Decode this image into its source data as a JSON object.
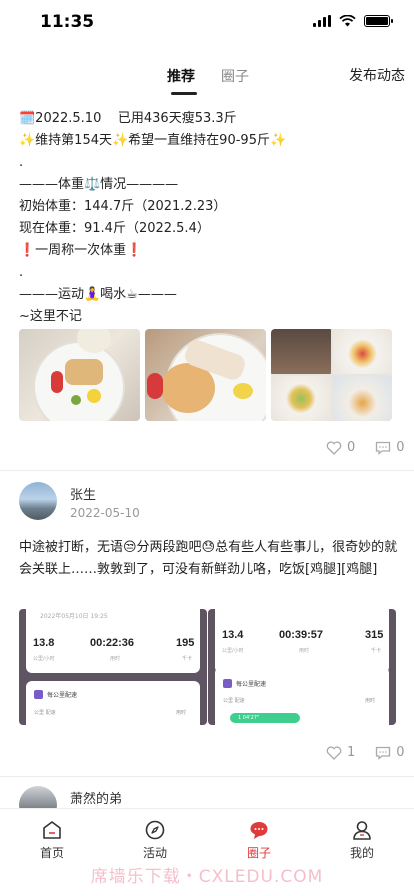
{
  "status_bar": {
    "time": "11:35"
  },
  "top_nav": {
    "tabs": [
      {
        "label": "推荐",
        "active": true
      },
      {
        "label": "圈子",
        "active": false
      }
    ],
    "publish_label": "发布动态"
  },
  "post1": {
    "lines": [
      "🗓️2022.5.10    已用436天瘦53.3斤",
      "✨维持第154天✨希望一直维持在90-95斤✨",
      ".",
      "———体重⚖️情况————",
      "初始体重：144.7斤（2021.2.23）",
      "现在体重：91.4斤（2022.5.4）",
      "❗一周称一次体重❗",
      ".",
      "———运动🧘‍♀️喝水☕———",
      "~这里不记"
    ],
    "likes": "0",
    "comments": "0"
  },
  "post2": {
    "username": "张生",
    "date": "2022-05-10",
    "text": "中途被打断，无语😒分两段跑吧😓总有些人有些事儿，很奇妙的就会关联上……敦敦到了，可没有新鲜劲儿咯，吃饭[鸡腿][鸡腿]",
    "screenshots": [
      {
        "header": "2022年05月10日 19:25",
        "distance": "13.8",
        "distance_label": "公里/小时",
        "duration": "00:22:36",
        "duration_label": "用时",
        "calories": "195",
        "calories_label": "千卡",
        "card_title": "每公里配速",
        "card_sub_left": "公里  配速",
        "card_sub_right": "用时"
      },
      {
        "header": "",
        "distance": "13.4",
        "distance_label": "公里/小时",
        "duration": "00:39:57",
        "duration_label": "用时",
        "calories": "315",
        "calories_label": "千卡",
        "card_title": "每公里配速",
        "card_sub_left": "公里  配速",
        "card_sub_right": "用时",
        "bar_label": "1  04'27\""
      }
    ],
    "likes": "1",
    "comments": "0"
  },
  "post3": {
    "username": "萧然的弟"
  },
  "tab_bar": {
    "items": [
      {
        "label": "首页",
        "icon": "home-icon"
      },
      {
        "label": "活动",
        "icon": "compass-icon"
      },
      {
        "label": "圈子",
        "icon": "chat-bubble-icon",
        "active": true
      },
      {
        "label": "我的",
        "icon": "person-icon"
      }
    ],
    "active_color": "#e03a3a"
  },
  "watermark": "席墙乐下载・CXLEDU.COM"
}
